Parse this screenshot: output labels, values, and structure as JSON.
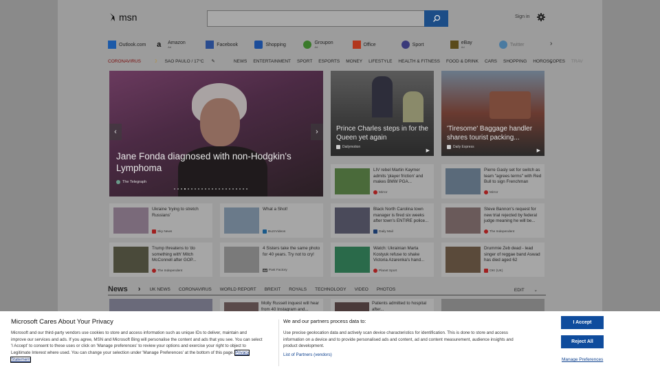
{
  "header": {
    "logo_text": "msn",
    "signin": "Sign in"
  },
  "quicklinks": [
    {
      "label": "Outlook.com",
      "sub": ""
    },
    {
      "label": "Amazon",
      "sub": "Ad"
    },
    {
      "label": "Facebook",
      "sub": ""
    },
    {
      "label": "Shopping",
      "sub": ""
    },
    {
      "label": "Groupon",
      "sub": "Ad"
    },
    {
      "label": "Office",
      "sub": ""
    },
    {
      "label": "Sport",
      "sub": ""
    },
    {
      "label": "eBay",
      "sub": "Ad"
    },
    {
      "label": "Twitter",
      "sub": ""
    }
  ],
  "nav": {
    "coronavirus": "CORONAVIRUS",
    "weather": "SAO PAULO / 17°C",
    "items": [
      "NEWS",
      "ENTERTAINMENT",
      "SPORT",
      "ESPORTS",
      "MONEY",
      "LIFESTYLE",
      "HEALTH & FITNESS",
      "FOOD & DRINK",
      "CARS",
      "SHOPPING",
      "HOROSCOPES",
      "TRAV"
    ]
  },
  "hero": {
    "title": "Jane Fonda diagnosed with non-Hodgkin's Lymphoma",
    "source": "The Telegraph"
  },
  "med1": {
    "title": "Prince Charles steps in for the Queen yet again",
    "source": "Dailymotion"
  },
  "med2": {
    "title": "'Tiresome' Baggage handler shares tourist packing...",
    "source": "Daily Express"
  },
  "cards": [
    {
      "title": "LIV rebel Martin Kaymer admits 'player friction' and makes BMW PGA...",
      "source": "Mirror"
    },
    {
      "title": "Pierre Gasly set for switch as team \"agrees terms\" with Red Bull to sign Frenchman",
      "source": "Mirror"
    },
    {
      "title": "Ukraine 'trying to stretch Russians'",
      "source": "Sky News"
    },
    {
      "title": "What a Shot!",
      "source": "BuzzVideos"
    },
    {
      "title": "Black North Carolina town manager is fired six weeks after town's ENTIRE police...",
      "source": "Daily Mail"
    },
    {
      "title": "Steve Bannon's request for new trial rejected by federal judge meaning he will be...",
      "source": "The Independent"
    },
    {
      "title": "Trump threatens to 'do something with' Mitch McConnell after GOP...",
      "source": "The Independent"
    },
    {
      "title": "4 Sisters take the same photo for 40 years. Try not to cry!",
      "source": "Past Factory",
      "ad": "Ad"
    },
    {
      "title": "Watch: Ukrainian Marta Kostyuk refuse to shake Victoria Azarenka's hand...",
      "source": "Planet Sport"
    },
    {
      "title": "Drummie Zeb dead - lead singer of reggae band Aswad has died aged 62",
      "source": "OK! (UK)"
    }
  ],
  "newsbar": {
    "heading": "News",
    "items": [
      "UK NEWS",
      "CORONAVIRUS",
      "WORLD REPORT",
      "BREXIT",
      "ROYALS",
      "TECHNOLOGY",
      "VIDEO",
      "PHOTOS"
    ],
    "edit": "EDIT"
  },
  "bottom": [
    "Molly Russell inquest will hear from 40 Instagram and...",
    "Patients admitted to hospital after..."
  ],
  "privacy": {
    "title": "Microsoft Cares About Your Privacy",
    "text": "Microsoft and our third-party vendors use cookies to store and access information such as unique IDs to deliver, maintain and improve our services and ads. If you agree, MSN and Microsoft Bing will personalise the content and ads that you see. You can select 'I Accept' to consent to these uses or click on 'Manage preferences' to review your options and exercise your right to object to Legitimate Interest where used. You can change your selection under 'Manage Preferences' at the bottom of this page.",
    "link": "Privacy Statement",
    "title2": "We and our partners process data to:",
    "text2": "Use precise geolocation data and actively scan device characteristics for identification. This is done to store and access information on a device and to provide personalised ads and content, ad and content measurement, audience insights and product development.",
    "partners": "List of Partners (vendors)",
    "accept": "I Accept",
    "reject": "Reject All",
    "manage": "Manage Preferences"
  }
}
